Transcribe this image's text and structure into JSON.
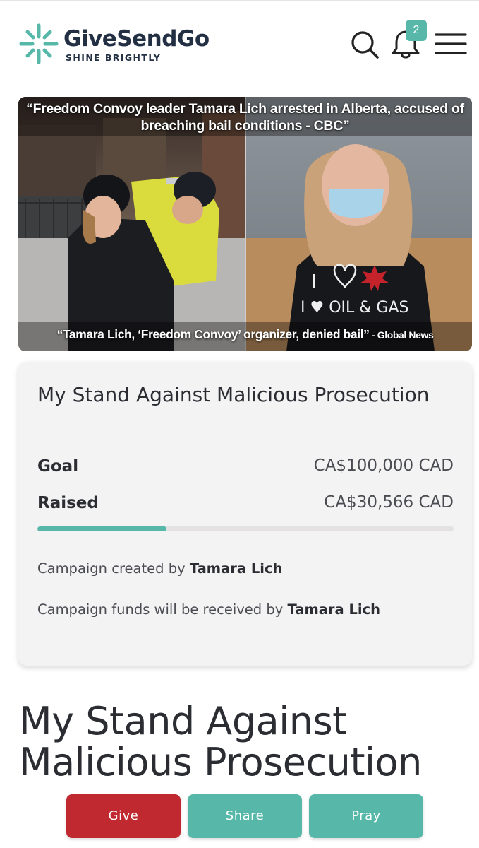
{
  "header": {
    "brand_name": "GiveSendGo",
    "tagline": "SHINE BRIGHTLY",
    "notification_count": "2",
    "icons": [
      "logo-star-icon",
      "search-icon",
      "bell-icon",
      "hamburger-menu-icon"
    ]
  },
  "hero": {
    "quote_top": "“Freedom Convoy leader Tamara Lich arrested in Alberta, accused of breaching bail conditions - CBC”",
    "quote_bottom": "“Tamara Lich, ‘Freedom Convoy’ organizer, denied bail”",
    "quote_bottom_source": " - Global News",
    "sweater_text": "I ♥ OIL & GAS"
  },
  "campaign": {
    "title": "My Stand Against Malicious Prosecution",
    "goal_label": "Goal",
    "goal_value": "CA$100,000 CAD",
    "raised_label": "Raised",
    "raised_value": "CA$30,566 CAD",
    "progress_fraction": 0.31,
    "created_by_label": "Campaign created by ",
    "created_by_name": "Tamara Lich",
    "funds_label": "Campaign funds will be received by ",
    "funds_name": "Tamara Lich"
  },
  "main": {
    "title": "My Stand Against Malicious Prosecution"
  },
  "actions": {
    "give_label": "Give",
    "share_label": "Share",
    "pray_label": "Pray"
  },
  "colors": {
    "brand_teal": "#57b8a9",
    "brand_navy": "#233044",
    "give_red": "#c0292f",
    "card_bg": "#f3f3f4"
  }
}
